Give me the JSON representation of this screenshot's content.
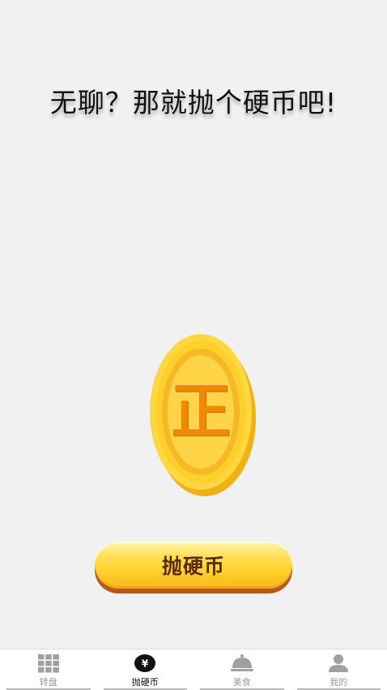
{
  "title": "无聊？那就抛个硬币吧!",
  "coin": {
    "face_char": "正",
    "colors": {
      "rim": "#ffd23a",
      "rim_edge": "#f2b417",
      "inner_ring": "#f7c52a",
      "face": "#ffd243",
      "text": "#f08a00"
    }
  },
  "toss_button": {
    "label": "抛硬币"
  },
  "tabbar": {
    "items": [
      {
        "label": "转盘",
        "icon": "grid-icon",
        "active": false
      },
      {
        "label": "抛硬币",
        "icon": "coin-yuan-icon",
        "active": true
      },
      {
        "label": "美食",
        "icon": "cloche-icon",
        "active": false
      },
      {
        "label": "我的",
        "icon": "user-icon",
        "active": false
      }
    ],
    "colors": {
      "inactive": "#9a9a9a",
      "active": "#111111"
    }
  }
}
